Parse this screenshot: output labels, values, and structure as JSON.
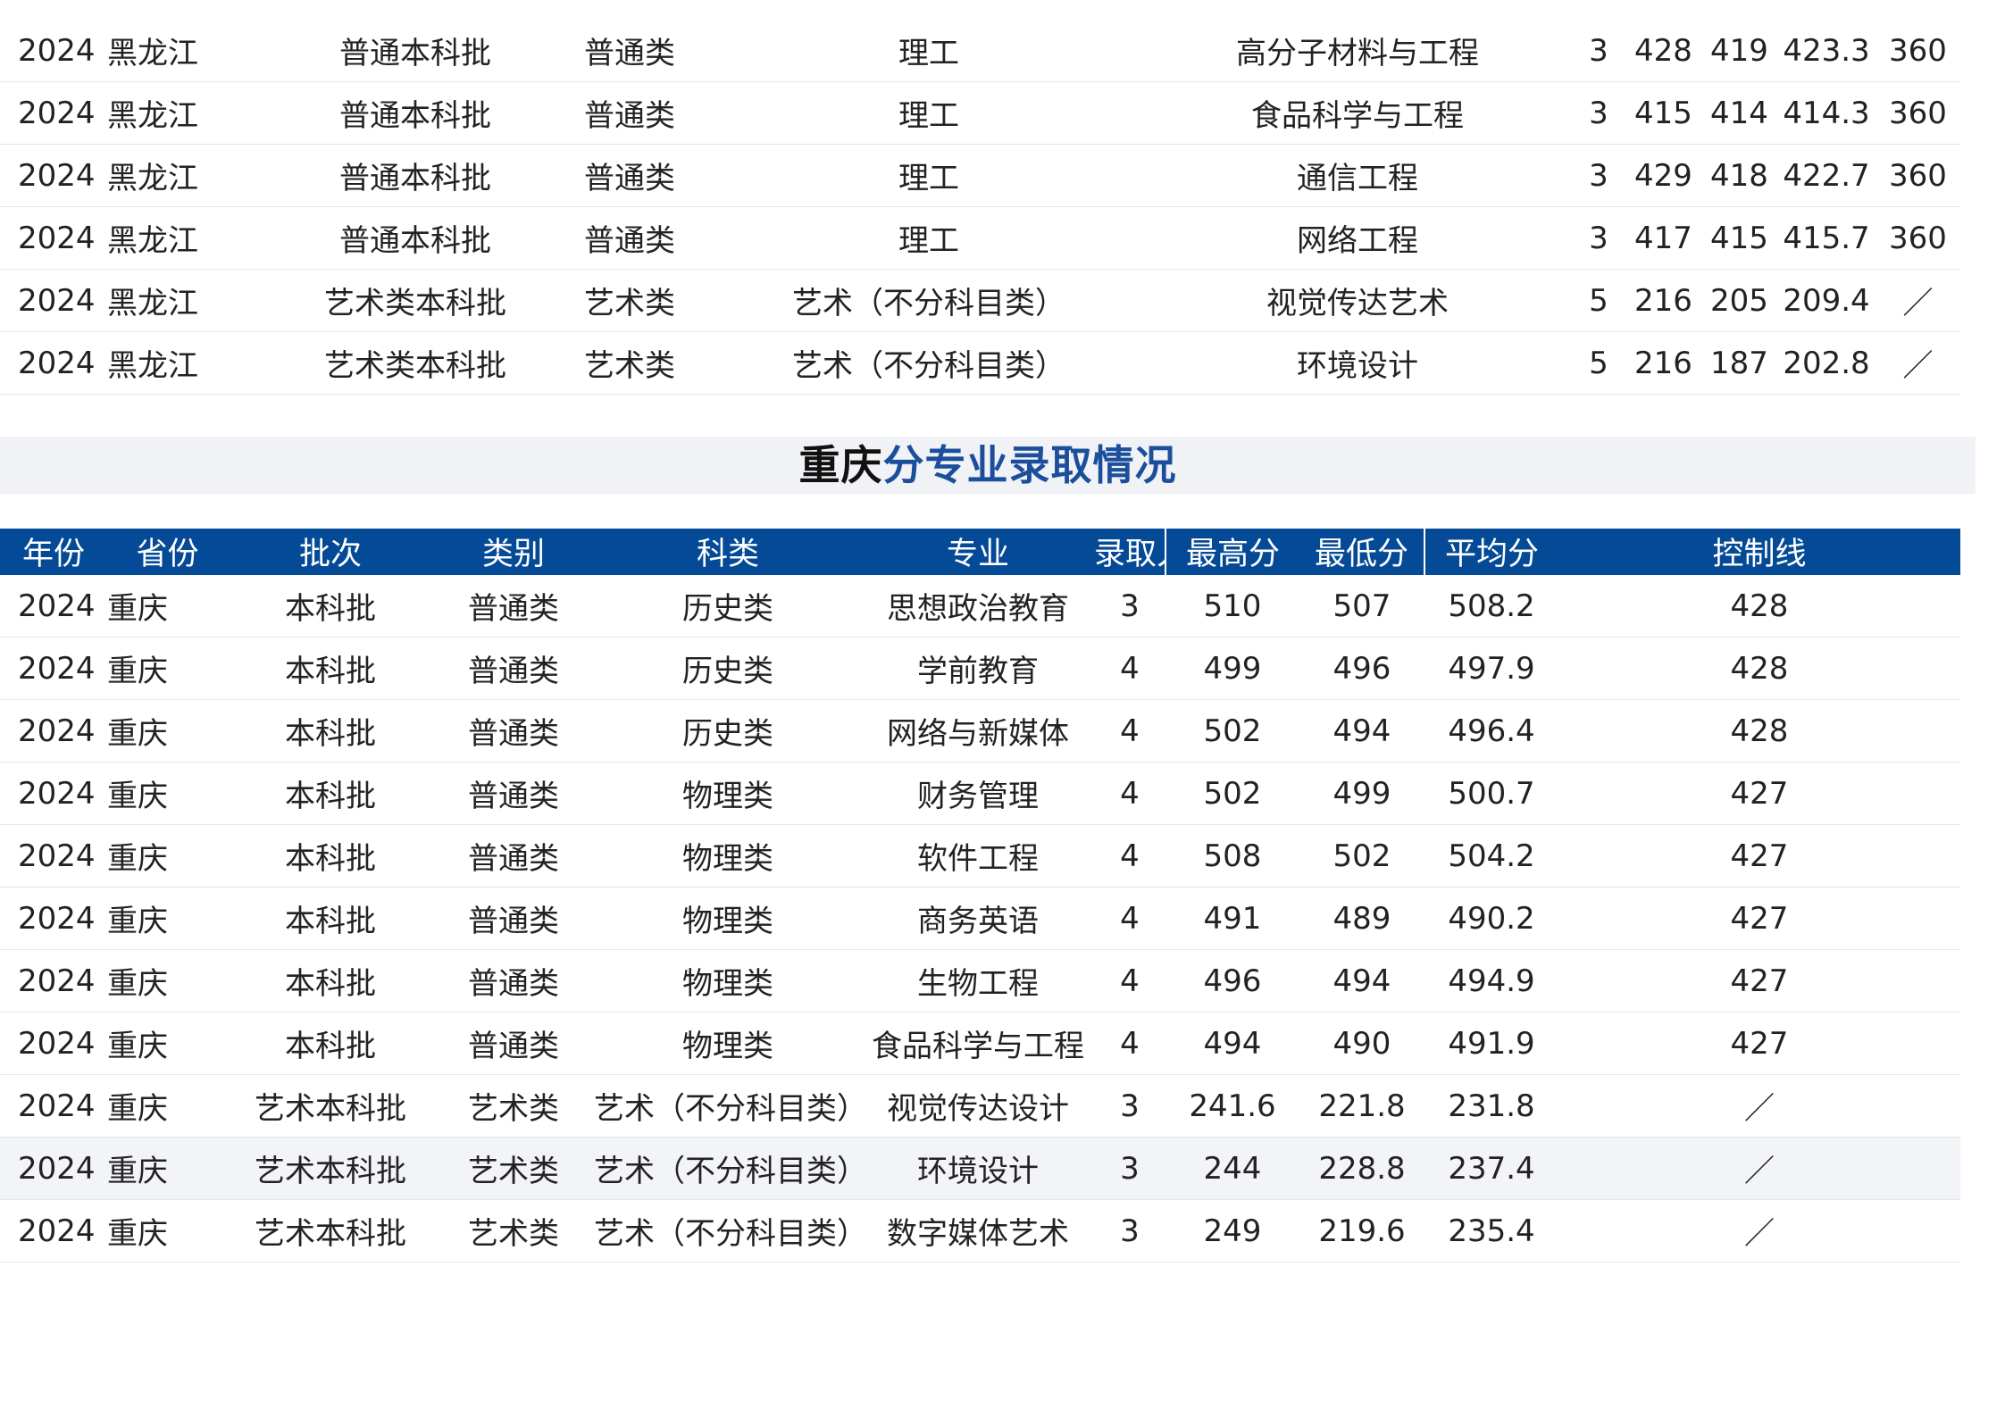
{
  "top_table": {
    "rows": [
      [
        "2024",
        "黑龙江",
        "普通本科批",
        "普通类",
        "理工",
        "高分子材料与工程",
        "3",
        "428",
        "419",
        "423.3",
        "360"
      ],
      [
        "2024",
        "黑龙江",
        "普通本科批",
        "普通类",
        "理工",
        "食品科学与工程",
        "3",
        "415",
        "414",
        "414.3",
        "360"
      ],
      [
        "2024",
        "黑龙江",
        "普通本科批",
        "普通类",
        "理工",
        "通信工程",
        "3",
        "429",
        "418",
        "422.7",
        "360"
      ],
      [
        "2024",
        "黑龙江",
        "普通本科批",
        "普通类",
        "理工",
        "网络工程",
        "3",
        "417",
        "415",
        "415.7",
        "360"
      ],
      [
        "2024",
        "黑龙江",
        "艺术类本科批",
        "艺术类",
        "艺术（不分科目类）",
        "视觉传达艺术",
        "5",
        "216",
        "205",
        "209.4",
        "／"
      ],
      [
        "2024",
        "黑龙江",
        "艺术类本科批",
        "艺术类",
        "艺术（不分科目类）",
        "环境设计",
        "5",
        "216",
        "187",
        "202.8",
        "／"
      ]
    ]
  },
  "section_title": {
    "part1": "重庆",
    "part2": "分专业录取情况"
  },
  "bottom_table": {
    "headers": [
      "年份",
      "省份",
      "批次",
      "类别",
      "科类",
      "专业",
      "录取人数",
      "最高分",
      "最低分",
      "平均分",
      "控制线"
    ],
    "rows": [
      [
        "2024",
        "重庆",
        "本科批",
        "普通类",
        "历史类",
        "思想政治教育",
        "3",
        "510",
        "507",
        "508.2",
        "428"
      ],
      [
        "2024",
        "重庆",
        "本科批",
        "普通类",
        "历史类",
        "学前教育",
        "4",
        "499",
        "496",
        "497.9",
        "428"
      ],
      [
        "2024",
        "重庆",
        "本科批",
        "普通类",
        "历史类",
        "网络与新媒体",
        "4",
        "502",
        "494",
        "496.4",
        "428"
      ],
      [
        "2024",
        "重庆",
        "本科批",
        "普通类",
        "物理类",
        "财务管理",
        "4",
        "502",
        "499",
        "500.7",
        "427"
      ],
      [
        "2024",
        "重庆",
        "本科批",
        "普通类",
        "物理类",
        "软件工程",
        "4",
        "508",
        "502",
        "504.2",
        "427"
      ],
      [
        "2024",
        "重庆",
        "本科批",
        "普通类",
        "物理类",
        "商务英语",
        "4",
        "491",
        "489",
        "490.2",
        "427"
      ],
      [
        "2024",
        "重庆",
        "本科批",
        "普通类",
        "物理类",
        "生物工程",
        "4",
        "496",
        "494",
        "494.9",
        "427"
      ],
      [
        "2024",
        "重庆",
        "本科批",
        "普通类",
        "物理类",
        "食品科学与工程",
        "4",
        "494",
        "490",
        "491.9",
        "427"
      ],
      [
        "2024",
        "重庆",
        "艺术本科批",
        "艺术类",
        "艺术（不分科目类）",
        "视觉传达设计",
        "3",
        "241.6",
        "221.8",
        "231.8",
        "／"
      ],
      [
        "2024",
        "重庆",
        "艺术本科批",
        "艺术类",
        "艺术（不分科目类）",
        "环境设计",
        "3",
        "244",
        "228.8",
        "237.4",
        "／"
      ],
      [
        "2024",
        "重庆",
        "艺术本科批",
        "艺术类",
        "艺术（不分科目类）",
        "数字媒体艺术",
        "3",
        "249",
        "219.6",
        "235.4",
        "／"
      ]
    ]
  }
}
